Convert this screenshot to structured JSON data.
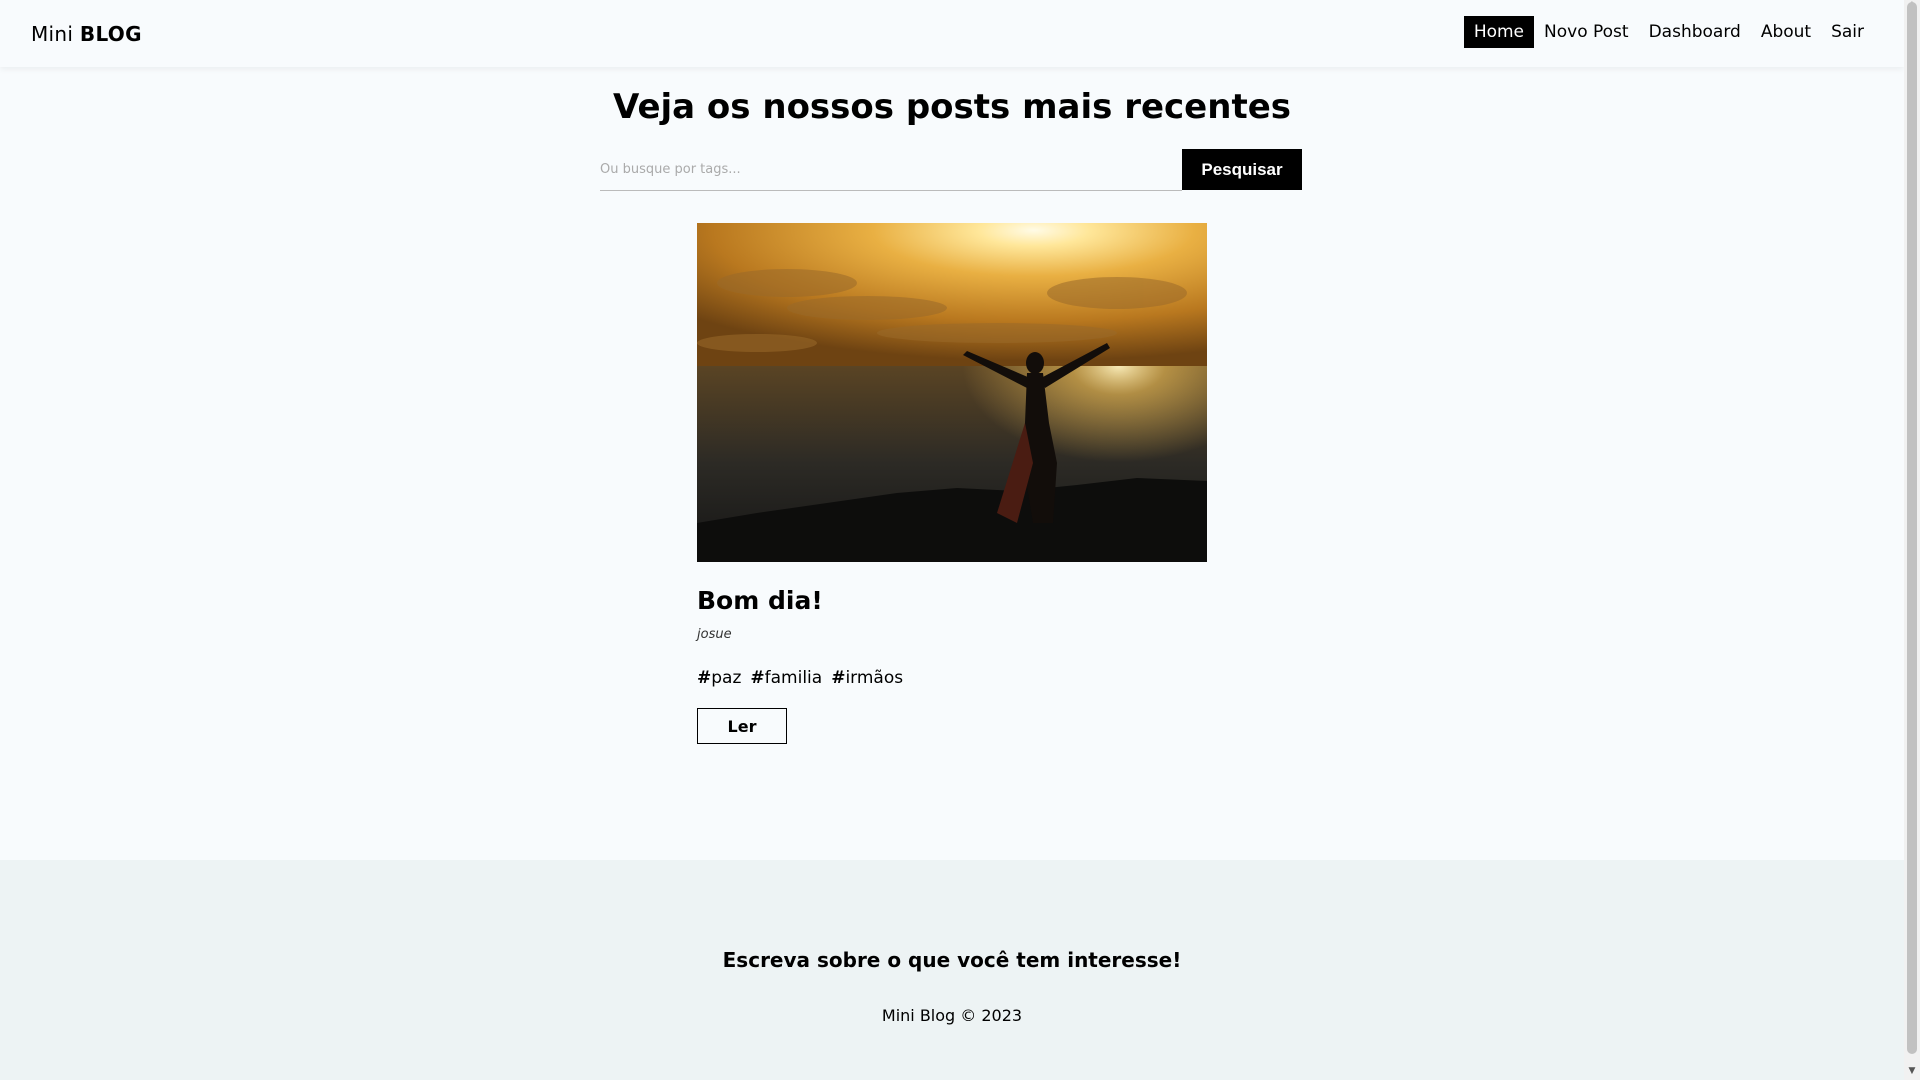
{
  "navbar": {
    "brand_light": "Mini ",
    "brand_bold": "BLOG",
    "links": [
      "Home",
      "Novo Post",
      "Dashboard",
      "About",
      "Sair"
    ],
    "active": "Home"
  },
  "main": {
    "headline": "Veja os nossos posts mais recentes",
    "search": {
      "placeholder": "Ou busque por tags...",
      "button_label": "Pesquisar"
    }
  },
  "post": {
    "image_alt": "Silhouette of a woman with raised arms at sunset over the sea",
    "title": "Bom dia!",
    "author": "josue",
    "tags": [
      {
        "hash": "#",
        "name": "paz"
      },
      {
        "hash": "#",
        "name": "familia"
      },
      {
        "hash": "#",
        "name": "irmãos"
      }
    ],
    "read_label": "Ler"
  },
  "footer": {
    "tagline": "Escreva sobre o que você tem interesse!",
    "copyright": "Mini Blog © 2023"
  },
  "colors": {
    "background": "#f8fbfd",
    "footer_bg": "#edf3f4",
    "accent": "#000000"
  }
}
